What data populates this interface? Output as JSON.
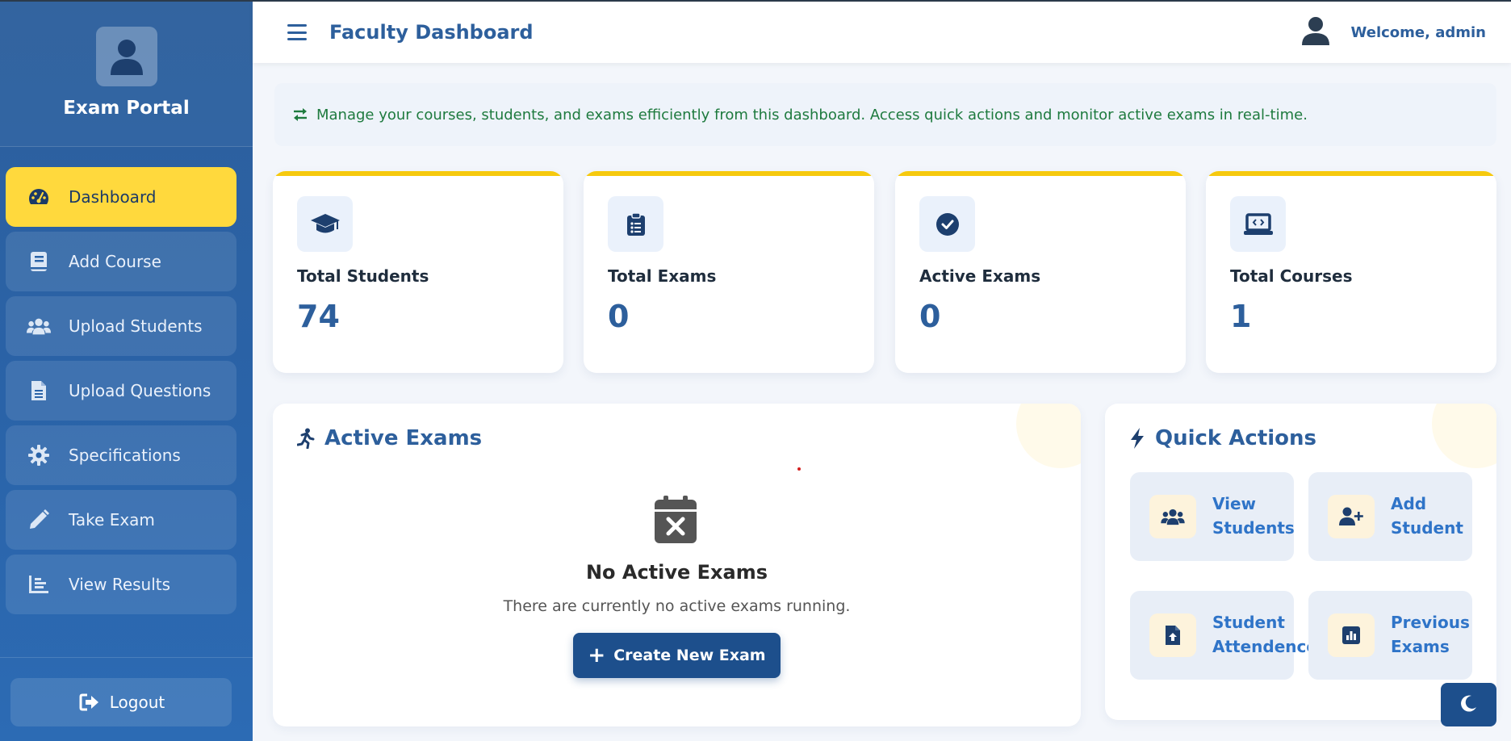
{
  "sidebar": {
    "brand_title": "Exam Portal",
    "items": [
      {
        "label": "Dashboard",
        "icon": "gauge-icon",
        "active": true
      },
      {
        "label": "Add Course",
        "icon": "book-icon"
      },
      {
        "label": "Upload Students",
        "icon": "users-icon"
      },
      {
        "label": "Upload Questions",
        "icon": "file-icon"
      },
      {
        "label": "Specifications",
        "icon": "gear-icon"
      },
      {
        "label": "Take Exam",
        "icon": "pencil-icon"
      },
      {
        "label": "View Results",
        "icon": "bar-chart-icon"
      }
    ],
    "logout_label": "Logout"
  },
  "header": {
    "title": "Faculty Dashboard",
    "welcome": "Welcome, admin"
  },
  "banner": {
    "text": "Manage your courses, students, and exams efficiently from this dashboard. Access quick actions and monitor active exams in real-time."
  },
  "stats": [
    {
      "label": "Total Students",
      "value": "74",
      "icon": "graduation-cap-icon"
    },
    {
      "label": "Total Exams",
      "value": "0",
      "icon": "clipboard-list-icon"
    },
    {
      "label": "Active Exams",
      "value": "0",
      "icon": "check-circle-icon"
    },
    {
      "label": "Total Courses",
      "value": "1",
      "icon": "laptop-code-icon"
    }
  ],
  "active_exams": {
    "title": "Active Exams",
    "empty_title": "No Active Exams",
    "empty_subtitle": "There are currently no active exams running.",
    "create_label": "Create New Exam"
  },
  "quick_actions": {
    "title": "Quick Actions",
    "items": [
      {
        "label": "View\nStudents",
        "icon": "users-icon"
      },
      {
        "label": "Add\nStudent",
        "icon": "user-plus-icon"
      },
      {
        "label": "Student\nAttendence",
        "icon": "file-upload-icon"
      },
      {
        "label": "Previous\nExams",
        "icon": "chart-square-icon"
      }
    ]
  },
  "colors": {
    "primary": "#2d5f9c",
    "accent": "#ffd93d",
    "button_dark": "#1d4f8c",
    "banner_text": "#1e7a3e"
  }
}
